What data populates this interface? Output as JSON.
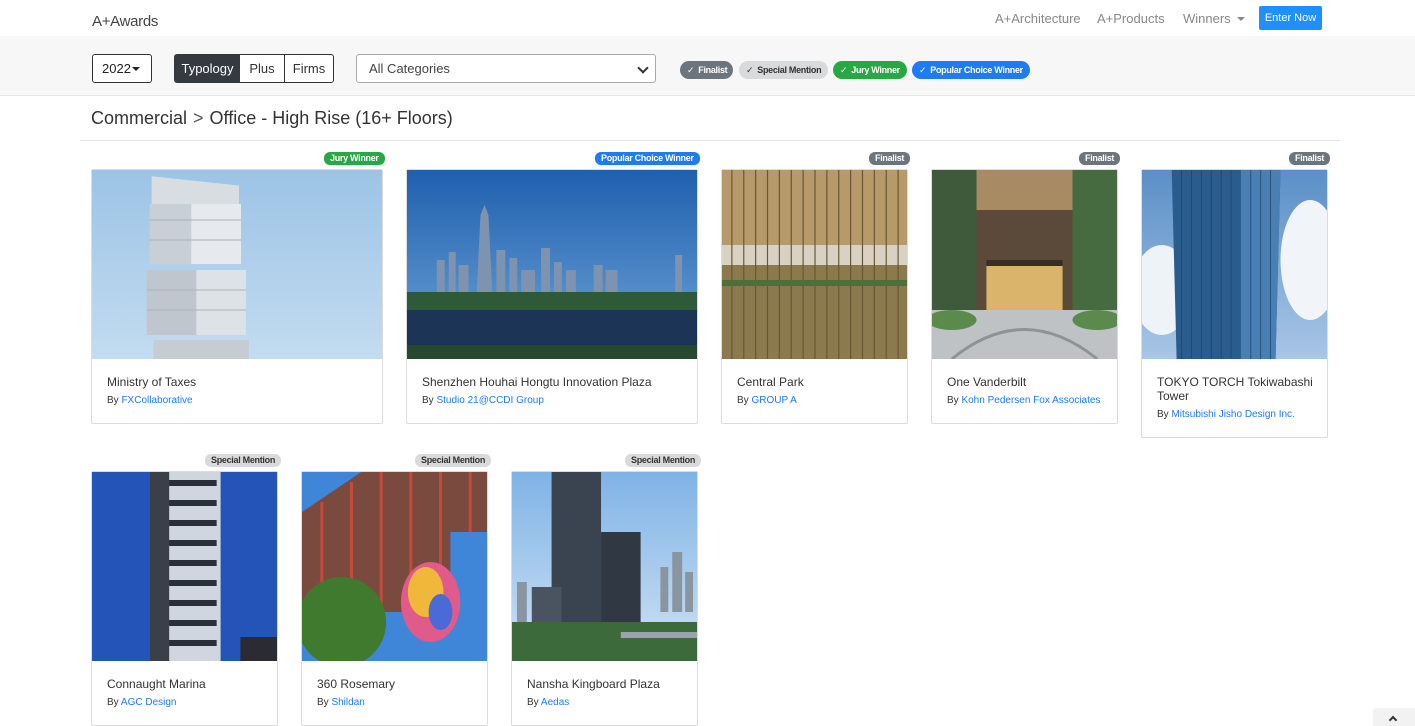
{
  "nav": {
    "brand": "A+Awards",
    "links": [
      "A+Architecture",
      "A+Products",
      "Winners"
    ],
    "enter_label": "Enter Now"
  },
  "filters": {
    "year": "2022",
    "segments": [
      "Typology",
      "Plus",
      "Firms"
    ],
    "category_selected": "All Categories",
    "pills": [
      "Finalist",
      "Special Mention",
      "Jury Winner",
      "Popular Choice Winner"
    ]
  },
  "heading": {
    "parent": "Commercial",
    "separator": ">",
    "current": "Office - High Rise (16+ Floors)"
  },
  "cards": [
    {
      "badge": "Jury Winner",
      "title": "Ministry of Taxes",
      "by": "By",
      "firm": "FXCollaborative"
    },
    {
      "badge": "Popular Choice Winner",
      "title": "Shenzhen Houhai Hongtu Innovation Plaza",
      "by": "By",
      "firm": "Studio 21@CCDI Group"
    },
    {
      "badge": "Finalist",
      "title": "Central Park",
      "by": "By",
      "firm": "GROUP A"
    },
    {
      "badge": "Finalist",
      "title": "One Vanderbilt",
      "by": "By",
      "firm": "Kohn Pedersen Fox Associates"
    },
    {
      "badge": "Finalist",
      "title": "TOKYO TORCH Tokiwabashi Tower",
      "by": "By",
      "firm": "Mitsubishi Jisho Design Inc."
    },
    {
      "badge": "Special Mention",
      "title": "Connaught Marina",
      "by": "By",
      "firm": "AGC Design"
    },
    {
      "badge": "Special Mention",
      "title": "360 Rosemary",
      "by": "By",
      "firm": "Shildan"
    },
    {
      "badge": "Special Mention",
      "title": "Nansha Kingboard Plaza",
      "by": "By",
      "firm": "Aedas"
    }
  ],
  "colors": {
    "finalist": "#6c757d",
    "special_mention": "#d9dadb",
    "jury_winner": "#28a745",
    "popular_choice": "#1e7bf2",
    "link": "#1e7bf2"
  }
}
